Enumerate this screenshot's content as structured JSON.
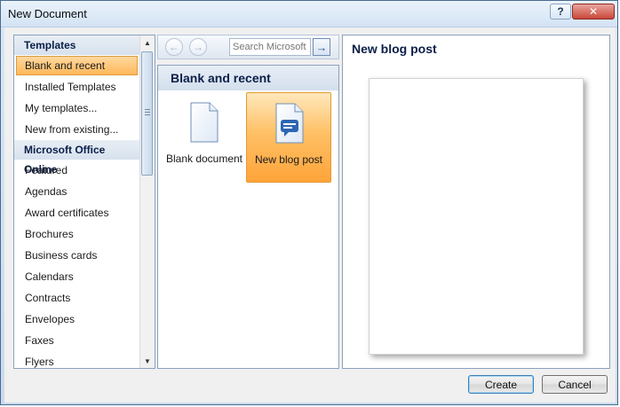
{
  "window": {
    "title": "New Document"
  },
  "titlebar": {
    "help_label": "?",
    "close_label": "✕"
  },
  "sidebar": {
    "sections": [
      {
        "header": "Templates",
        "items": [
          "Blank and recent",
          "Installed Templates",
          "My templates...",
          "New from existing..."
        ]
      },
      {
        "header": "Microsoft Office Online",
        "items": [
          "Featured",
          "Agendas",
          "Award certificates",
          "Brochures",
          "Business cards",
          "Calendars",
          "Contracts",
          "Envelopes",
          "Faxes",
          "Flyers"
        ]
      }
    ],
    "selected": "Blank and recent"
  },
  "toolbar": {
    "search_placeholder": "Search Microsoft",
    "back_icon": "back-arrow-icon",
    "forward_icon": "forward-arrow-icon",
    "go_icon": "arrow-right-icon"
  },
  "main": {
    "section_title": "Blank and recent",
    "templates": [
      {
        "label": "Blank document",
        "icon": "blank-document-icon",
        "selected": false
      },
      {
        "label": "New blog post",
        "icon": "blog-post-icon",
        "selected": true
      }
    ]
  },
  "preview": {
    "title": "New blog post"
  },
  "buttons": {
    "create": "Create",
    "cancel": "Cancel"
  },
  "colors": {
    "selection": "#ffb85a",
    "accent_text": "#0b1f48",
    "frame": "#c9daee"
  }
}
